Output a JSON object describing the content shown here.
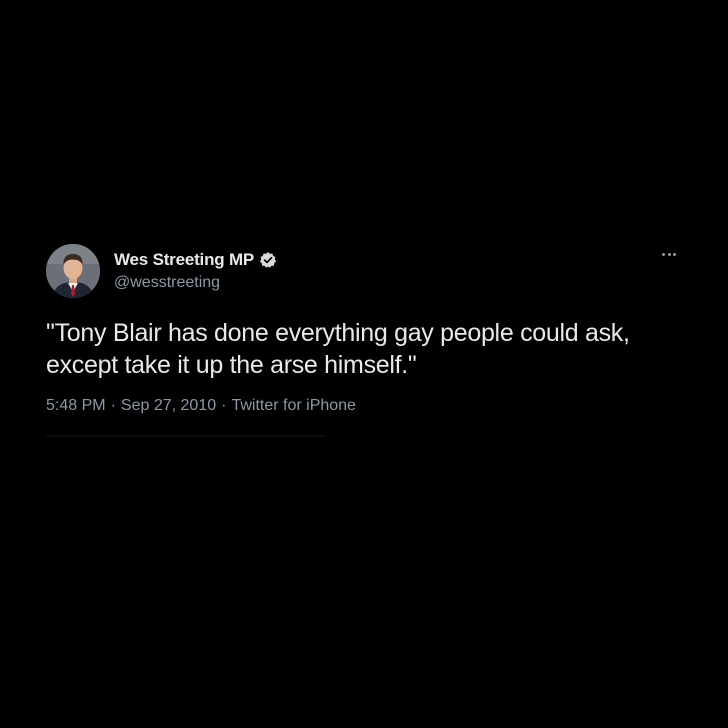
{
  "author": {
    "display_name": "Wes Streeting MP",
    "handle": "@wesstreeting",
    "verified": true
  },
  "tweet": {
    "text_line1": "\"Tony Blair has done everything gay people could ask,",
    "text_line2": "except take it up the arse himself.\""
  },
  "meta": {
    "time": "5:48 PM",
    "date": "Sep 27, 2010",
    "source": "Twitter for iPhone",
    "separator": "·"
  },
  "icons": {
    "verified": "verified-badge-icon",
    "more": "more-options-icon"
  },
  "colors": {
    "background": "#000000",
    "primary_text": "#e7e9ea",
    "secondary_text": "#8b98a5",
    "badge": "#d9d9d9"
  }
}
